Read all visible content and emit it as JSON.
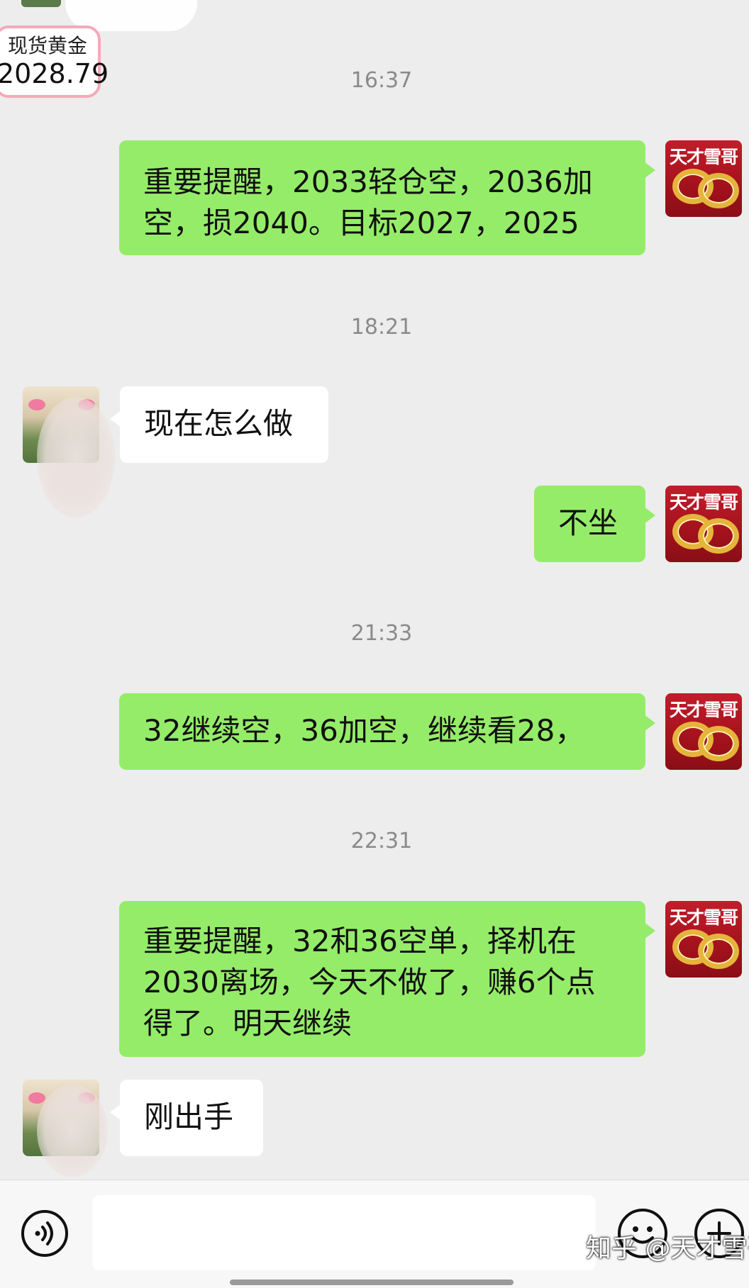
{
  "ticker": {
    "name": "现货黄金",
    "price": "2028.79"
  },
  "messages": [
    {
      "type": "time",
      "text": "16:37"
    },
    {
      "type": "me",
      "text": "重要提醒，2033轻仓空，2036加空，损2040。目标2027，2025"
    },
    {
      "type": "time",
      "text": "18:21"
    },
    {
      "type": "other",
      "text": "现在怎么做"
    },
    {
      "type": "me",
      "text": "不坐"
    },
    {
      "type": "time",
      "text": "21:33"
    },
    {
      "type": "me",
      "text": "32继续空，36加空，继续看28，"
    },
    {
      "type": "time",
      "text": "22:31"
    },
    {
      "type": "me",
      "text": "重要提醒，32和36空单，择机在2030离场，今天不做了，赚6个点得了。明天继续"
    },
    {
      "type": "other",
      "text": "刚出手"
    }
  ],
  "me_avatar_label": "天才雪哥",
  "input_bar": {
    "voice_icon": "voice-icon",
    "emoji_icon": "emoji-icon",
    "plus_icon": "plus-icon"
  },
  "watermark": "知乎 @天才雪哥",
  "colors": {
    "my_bubble": "#95ec69",
    "other_bubble": "#ffffff",
    "background": "#ededed"
  }
}
